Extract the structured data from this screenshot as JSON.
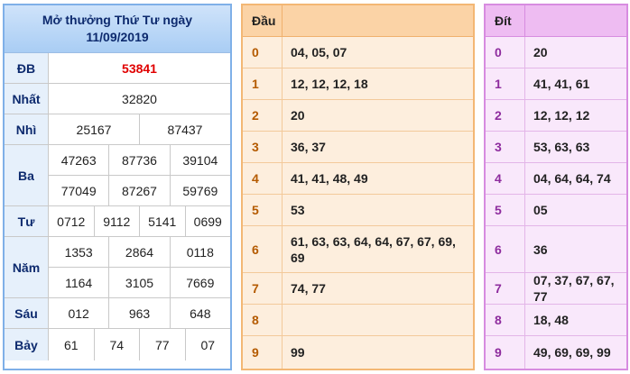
{
  "results": {
    "header_line1": "Mở thưởng Thứ Tư ngày",
    "header_line2": "11/09/2019",
    "rows": [
      {
        "label": "ĐB",
        "lines": [
          [
            "53841"
          ]
        ],
        "special": true
      },
      {
        "label": "Nhất",
        "lines": [
          [
            "32820"
          ]
        ]
      },
      {
        "label": "Nhì",
        "lines": [
          [
            "25167",
            "87437"
          ]
        ]
      },
      {
        "label": "Ba",
        "lines": [
          [
            "47263",
            "87736",
            "39104"
          ],
          [
            "77049",
            "87267",
            "59769"
          ]
        ]
      },
      {
        "label": "Tư",
        "lines": [
          [
            "0712",
            "9112",
            "5141",
            "0699"
          ]
        ]
      },
      {
        "label": "Năm",
        "lines": [
          [
            "1353",
            "2864",
            "0118"
          ],
          [
            "1164",
            "3105",
            "7669"
          ]
        ]
      },
      {
        "label": "Sáu",
        "lines": [
          [
            "012",
            "963",
            "648"
          ]
        ]
      },
      {
        "label": "Bảy",
        "lines": [
          [
            "61",
            "74",
            "77",
            "07"
          ]
        ]
      }
    ]
  },
  "dau": {
    "title": "Đầu",
    "rows": [
      {
        "key": "0",
        "value": "04, 05, 07"
      },
      {
        "key": "1",
        "value": "12, 12, 12, 18"
      },
      {
        "key": "2",
        "value": "20"
      },
      {
        "key": "3",
        "value": "36, 37"
      },
      {
        "key": "4",
        "value": "41, 41, 48, 49"
      },
      {
        "key": "5",
        "value": "53"
      },
      {
        "key": "6",
        "value": "61, 63, 63, 64, 64, 67, 67, 69, 69"
      },
      {
        "key": "7",
        "value": "74, 77"
      },
      {
        "key": "8",
        "value": ""
      },
      {
        "key": "9",
        "value": "99"
      }
    ]
  },
  "dit": {
    "title": "Đít",
    "rows": [
      {
        "key": "0",
        "value": "20"
      },
      {
        "key": "1",
        "value": "41, 41, 61"
      },
      {
        "key": "2",
        "value": "12, 12, 12"
      },
      {
        "key": "3",
        "value": "53, 63, 63"
      },
      {
        "key": "4",
        "value": "04, 64, 64, 74"
      },
      {
        "key": "5",
        "value": "05"
      },
      {
        "key": "6",
        "value": "36"
      },
      {
        "key": "7",
        "value": "07, 37, 67, 67, 77"
      },
      {
        "key": "8",
        "value": "18, 48"
      },
      {
        "key": "9",
        "value": "49, 69, 69, 99"
      }
    ]
  }
}
